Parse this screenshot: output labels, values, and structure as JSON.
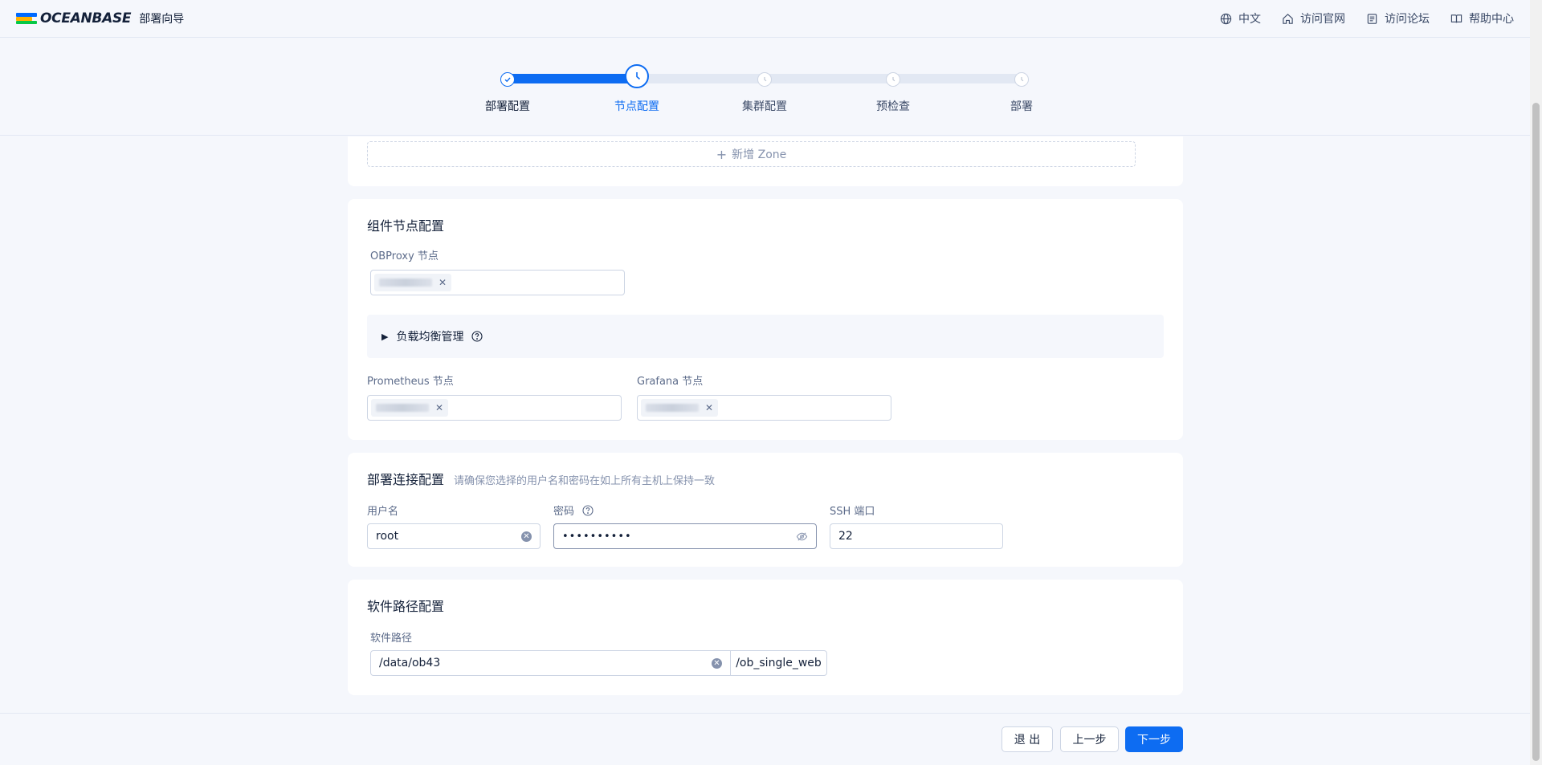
{
  "header": {
    "logo_text": "OCEANBASE",
    "title": "部署向导",
    "nav": [
      {
        "label": "中文",
        "icon": "globe-icon"
      },
      {
        "label": "访问官网",
        "icon": "home-icon"
      },
      {
        "label": "访问论坛",
        "icon": "forum-icon"
      },
      {
        "label": "帮助中心",
        "icon": "book-icon"
      }
    ]
  },
  "colors": {
    "primary": "#0d6cf2",
    "logo_blue": "#006aff",
    "logo_yellow": "#ffb100",
    "logo_green": "#07c846"
  },
  "steps": [
    {
      "label": "部署配置",
      "status": "done"
    },
    {
      "label": "节点配置",
      "status": "active"
    },
    {
      "label": "集群配置",
      "status": "pending"
    },
    {
      "label": "预检查",
      "status": "pending"
    },
    {
      "label": "部署",
      "status": "pending"
    }
  ],
  "zone": {
    "add_label": "新增 Zone"
  },
  "component": {
    "title": "组件节点配置",
    "obproxy_label": "OBProxy 节点",
    "lb_label": "负载均衡管理",
    "prometheus_label": "Prometheus 节点",
    "grafana_label": "Grafana 节点"
  },
  "connection": {
    "title": "部署连接配置",
    "hint": "请确保您选择的用户名和密码在如上所有主机上保持一致",
    "username_label": "用户名",
    "username_value": "root",
    "password_label": "密码",
    "password_value": "••••••••••",
    "ssh_label": "SSH 端口",
    "ssh_value": "22"
  },
  "software": {
    "title": "软件路径配置",
    "path_label": "软件路径",
    "path_value": "/data/ob43",
    "path_suffix": "/ob_single_web"
  },
  "footer": {
    "exit_label": "退 出",
    "prev_label": "上一步",
    "next_label": "下一步"
  }
}
